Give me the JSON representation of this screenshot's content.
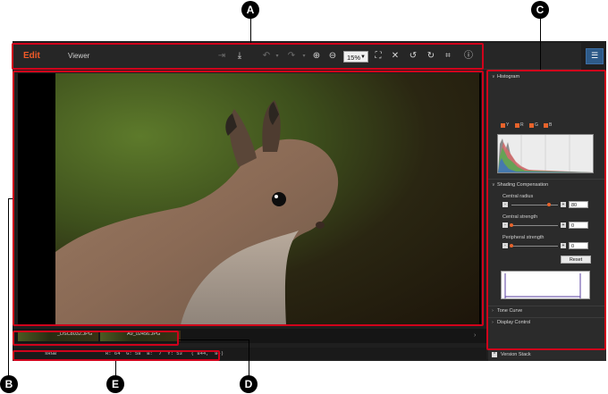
{
  "toolbar": {
    "tab_edit": "Edit",
    "tab_viewer": "Viewer",
    "zoom_value": "15%",
    "icons": [
      "export-icon",
      "save-icon",
      "undo-icon",
      "undo-history-icon",
      "redo-icon",
      "redo-history-icon",
      "zoom-in-icon",
      "zoom-out-icon",
      "fit-window-icon",
      "full-screen-icon",
      "rotate-left-icon",
      "rotate-right-icon",
      "crop-icon",
      "info-icon",
      "adjustments-icon"
    ]
  },
  "panel": {
    "histogram": {
      "title": "Histogram",
      "channels": [
        "Y",
        "R",
        "G",
        "B"
      ]
    },
    "shading": {
      "title": "Shading Compensation",
      "central_radius_label": "Central radius",
      "central_radius_value": "80",
      "central_radius_level": 0.8,
      "central_strength_label": "Central strength",
      "central_strength_value": "0",
      "central_strength_level": 0,
      "peripheral_strength_label": "Peripheral strength",
      "peripheral_strength_value": "0",
      "peripheral_strength_level": 0,
      "minus": "-",
      "plus": "+",
      "reset_label": "Reset"
    },
    "tone_curve": "Tone Curve",
    "display_control": "Display Control",
    "version_stack": "Version Stack"
  },
  "thumbnails": [
    {
      "label": "_DSC8032.JPG"
    },
    {
      "label": "A9_02456.JPG"
    }
  ],
  "status": {
    "color_space": "sRGB",
    "pixel_info": "R: 64  G: 58  B:  7  Y: 53   ( 844,  84)"
  },
  "callouts": {
    "a": "A",
    "b": "B",
    "c": "C",
    "d": "D",
    "e": "E"
  },
  "colors": {
    "accent": "#e8632b",
    "callout_frame": "#d0021b",
    "callout_badge": "#000000"
  }
}
